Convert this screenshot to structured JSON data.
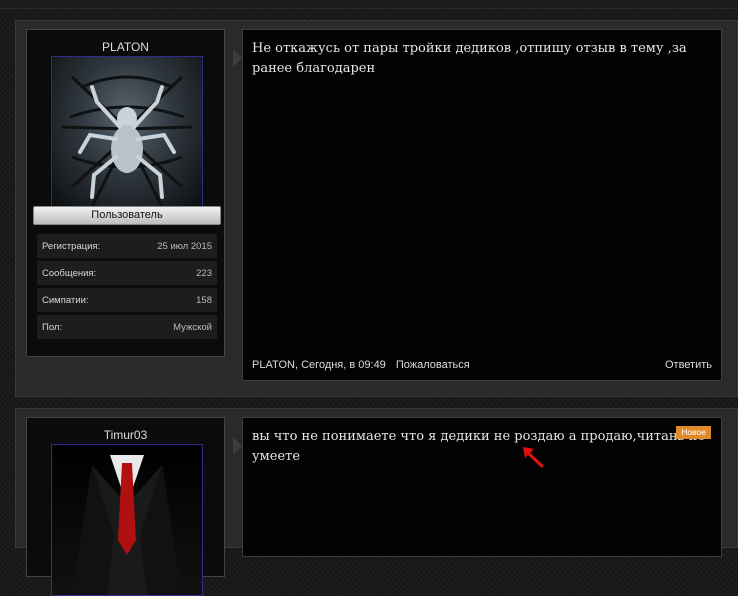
{
  "posts": [
    {
      "username": "PLATON",
      "role": "Пользователь",
      "stats": [
        {
          "label": "Регистрация:",
          "value": "25 июл 2015"
        },
        {
          "label": "Сообщения:",
          "value": "223"
        },
        {
          "label": "Симпатии:",
          "value": "158"
        },
        {
          "label": "Пол:",
          "value": "Мужской"
        }
      ],
      "message": "Не откажусь от пары тройки дедиков ,отпишу отзыв в тему ,за ранее благодарен",
      "author_time": "PLATON, Сегодня, в 09:49",
      "report_label": "Пожаловаться",
      "reply_label": "Ответить",
      "avatar_icon": "spider-avatar-icon"
    },
    {
      "username": "Timur03",
      "message": "вы что не понимаете что я дедики не роздаю а продаю,читань не умеете",
      "new_badge": "Новое",
      "avatar_icon": "suit-avatar-icon"
    }
  ],
  "colors": {
    "badge": "#e08a2a",
    "annotation_arrow": "#e01010"
  }
}
